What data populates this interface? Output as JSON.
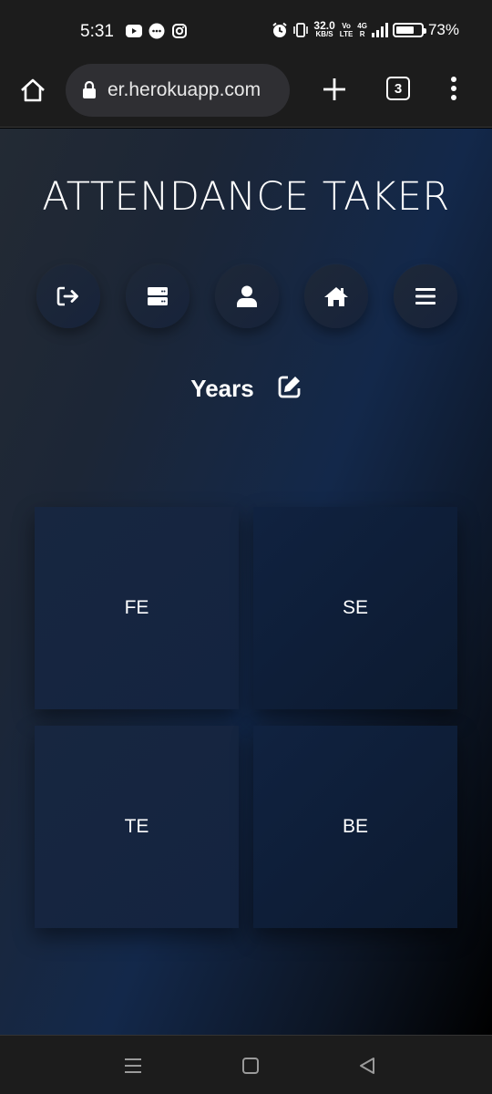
{
  "status_bar": {
    "time": "5:31",
    "speed_value": "32.0",
    "speed_unit": "KB/S",
    "network_volte": "Vo",
    "network_lte": "LTE",
    "network_type": "4G",
    "battery_percent": "73%",
    "battery_level": 0.73
  },
  "browser": {
    "url": "er.herokuapp.com",
    "tab_count": "3"
  },
  "app": {
    "title": "ATTENDANCE TAKER",
    "toolbar_icons": [
      "logout-icon",
      "server-icon",
      "user-icon",
      "home-icon",
      "menu-icon"
    ],
    "section_title": "Years",
    "years": [
      {
        "label": "FE"
      },
      {
        "label": "SE"
      },
      {
        "label": "TE"
      },
      {
        "label": "BE"
      }
    ]
  },
  "colors": {
    "status_bg": "#1c1c1c",
    "content_gradient_start": "#232a34",
    "content_gradient_mid": "#13284a",
    "content_gradient_end": "#000000",
    "card": "#152440"
  }
}
